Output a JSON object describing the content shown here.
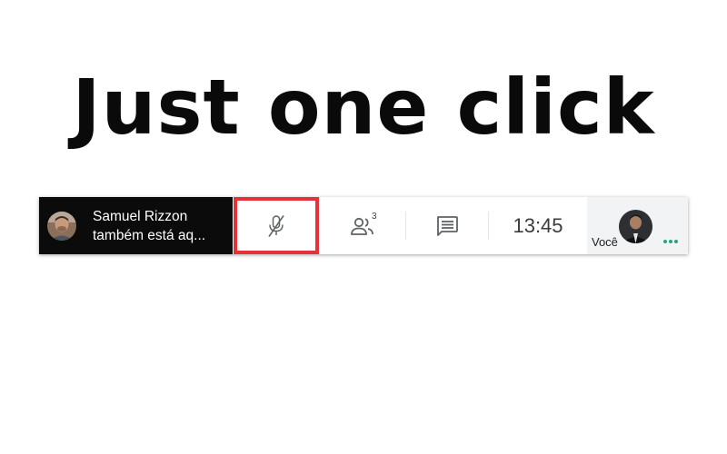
{
  "headline": "Just one click",
  "presence": {
    "name": "Samuel Rizzon",
    "status": "também está aq...",
    "avatar_icon": "user-avatar-photo"
  },
  "controls": {
    "mic_icon": "mic-off-icon",
    "highlight_color": "#e53238",
    "people_icon": "people-icon",
    "people_count": "3",
    "chat_icon": "chat-icon"
  },
  "clock": "13:45",
  "self_view": {
    "label": "Você",
    "avatar_icon": "user-avatar-photo",
    "menu_icon": "more-dots-icon",
    "dots_color": "#1ea784"
  },
  "colors": {
    "presence_bg": "#0b0b0b",
    "self_area_bg": "#f1f3f4",
    "icon_gray": "#5f6368"
  }
}
